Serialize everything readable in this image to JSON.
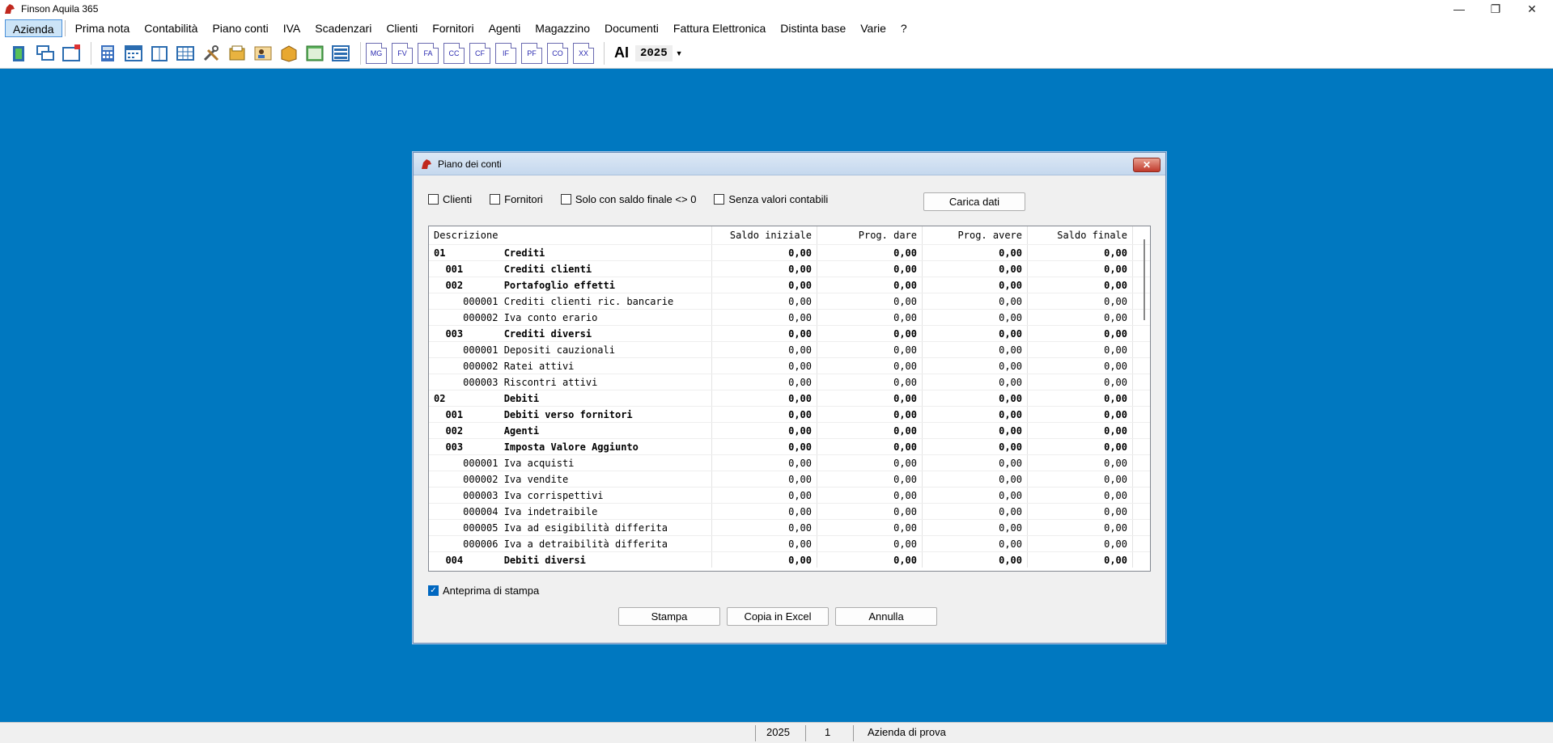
{
  "window": {
    "title": "Finson Aquila 365"
  },
  "menu": [
    "Azienda",
    "Prima nota",
    "Contabilità",
    "Piano conti",
    "IVA",
    "Scadenzari",
    "Clienti",
    "Fornitori",
    "Agenti",
    "Magazzino",
    "Documenti",
    "Fattura Elettronica",
    "Distinta base",
    "Varie",
    "?"
  ],
  "toolbar": {
    "text_buttons": [
      "MG",
      "FV",
      "FA",
      "CC",
      "CF",
      "IF",
      "PF",
      "CO",
      "XX"
    ],
    "ai_label": "AI",
    "year": "2025"
  },
  "dialog": {
    "title": "Piano dei conti",
    "filters": {
      "clienti": "Clienti",
      "fornitori": "Fornitori",
      "solo_saldo": "Solo con saldo finale <> 0",
      "senza_valori": "Senza valori contabili"
    },
    "load_button": "Carica dati",
    "columns": [
      "Descrizione",
      "Saldo iniziale",
      "Prog. dare",
      "Prog. avere",
      "Saldo finale"
    ],
    "rows": [
      {
        "desc": "01          Crediti",
        "bold": true,
        "v": [
          "0,00",
          "0,00",
          "0,00",
          "0,00"
        ]
      },
      {
        "desc": "  001       Crediti clienti",
        "bold": true,
        "v": [
          "0,00",
          "0,00",
          "0,00",
          "0,00"
        ]
      },
      {
        "desc": "  002       Portafoglio effetti",
        "bold": true,
        "v": [
          "0,00",
          "0,00",
          "0,00",
          "0,00"
        ]
      },
      {
        "desc": "     000001 Crediti clienti ric. bancarie",
        "bold": false,
        "v": [
          "0,00",
          "0,00",
          "0,00",
          "0,00"
        ]
      },
      {
        "desc": "     000002 Iva conto erario",
        "bold": false,
        "v": [
          "0,00",
          "0,00",
          "0,00",
          "0,00"
        ]
      },
      {
        "desc": "  003       Crediti diversi",
        "bold": true,
        "v": [
          "0,00",
          "0,00",
          "0,00",
          "0,00"
        ]
      },
      {
        "desc": "     000001 Depositi cauzionali",
        "bold": false,
        "v": [
          "0,00",
          "0,00",
          "0,00",
          "0,00"
        ]
      },
      {
        "desc": "     000002 Ratei attivi",
        "bold": false,
        "v": [
          "0,00",
          "0,00",
          "0,00",
          "0,00"
        ]
      },
      {
        "desc": "     000003 Riscontri attivi",
        "bold": false,
        "v": [
          "0,00",
          "0,00",
          "0,00",
          "0,00"
        ]
      },
      {
        "desc": "02          Debiti",
        "bold": true,
        "v": [
          "0,00",
          "0,00",
          "0,00",
          "0,00"
        ]
      },
      {
        "desc": "  001       Debiti verso fornitori",
        "bold": true,
        "v": [
          "0,00",
          "0,00",
          "0,00",
          "0,00"
        ]
      },
      {
        "desc": "  002       Agenti",
        "bold": true,
        "v": [
          "0,00",
          "0,00",
          "0,00",
          "0,00"
        ]
      },
      {
        "desc": "  003       Imposta Valore Aggiunto",
        "bold": true,
        "v": [
          "0,00",
          "0,00",
          "0,00",
          "0,00"
        ]
      },
      {
        "desc": "     000001 Iva acquisti",
        "bold": false,
        "v": [
          "0,00",
          "0,00",
          "0,00",
          "0,00"
        ]
      },
      {
        "desc": "     000002 Iva vendite",
        "bold": false,
        "v": [
          "0,00",
          "0,00",
          "0,00",
          "0,00"
        ]
      },
      {
        "desc": "     000003 Iva corrispettivi",
        "bold": false,
        "v": [
          "0,00",
          "0,00",
          "0,00",
          "0,00"
        ]
      },
      {
        "desc": "     000004 Iva indetraibile",
        "bold": false,
        "v": [
          "0,00",
          "0,00",
          "0,00",
          "0,00"
        ]
      },
      {
        "desc": "     000005 Iva ad esigibilità differita",
        "bold": false,
        "v": [
          "0,00",
          "0,00",
          "0,00",
          "0,00"
        ]
      },
      {
        "desc": "     000006 Iva a detraibilità differita",
        "bold": false,
        "v": [
          "0,00",
          "0,00",
          "0,00",
          "0,00"
        ]
      },
      {
        "desc": "  004       Debiti diversi",
        "bold": true,
        "v": [
          "0,00",
          "0,00",
          "0,00",
          "0,00"
        ]
      }
    ],
    "preview_label": "Anteprima di stampa",
    "buttons": {
      "print": "Stampa",
      "excel": "Copia in Excel",
      "cancel": "Annulla"
    }
  },
  "status": {
    "year": "2025",
    "num": "1",
    "company": "Azienda di prova"
  }
}
